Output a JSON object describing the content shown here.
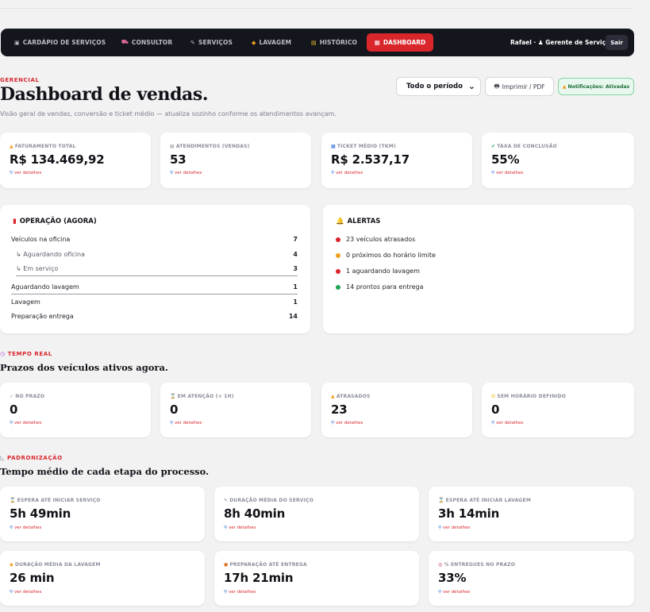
{
  "nav": {
    "items": [
      {
        "icon": "▣",
        "label": "CARDÁPIO DE SERVIÇOS"
      },
      {
        "icon": "⛟",
        "label": "CONSULTOR"
      },
      {
        "icon": "✎",
        "label": "SERVIÇOS"
      },
      {
        "icon": "◆",
        "label": "LAVAGEM"
      },
      {
        "icon": "▤",
        "label": "HISTÓRICO"
      }
    ],
    "active": {
      "icon": "▦",
      "label": "DASHBOARD"
    },
    "user": "Rafael · ♟ Gerente de Serviços",
    "logout": "Sair"
  },
  "header": {
    "eyebrow": "GERENCIAL",
    "title": "Dashboard de vendas.",
    "subtitle": "Visão geral de vendas, conversão e ticket médio — atualiza sozinho conforme os atendimentos avançam.",
    "period": "Todo o período",
    "print": "Imprimir / PDF",
    "notifications": "Notificações: Ativadas"
  },
  "link_label": "ver detalhes",
  "kpis": [
    {
      "icon": "▲",
      "label": "FATURAMENTO TOTAL",
      "value": "R$ 134.469,92"
    },
    {
      "icon": "▤",
      "label": "ATENDIMENTOS (VENDAS)",
      "value": "53"
    },
    {
      "icon": "▦",
      "label": "TICKET MÉDIO (TKM)",
      "value": "R$ 2.537,17"
    },
    {
      "icon": "✔",
      "label": "TAXA DE CONCLUSÃO",
      "value": "55%"
    }
  ],
  "operation": {
    "title": "OPERAÇÃO (AGORA)",
    "rows": [
      {
        "label": "Veículos na oficina",
        "value": "7"
      },
      {
        "label": "↳ Aguardando oficina",
        "value": "4"
      },
      {
        "label": "↳ Em serviço",
        "value": "3"
      },
      {
        "label": "Aguardando lavagem",
        "value": "1"
      },
      {
        "label": "Lavagem",
        "value": "1"
      },
      {
        "label": "Preparação entrega",
        "value": "14"
      }
    ]
  },
  "alerts": {
    "title": "ALERTAS",
    "items": [
      {
        "text": "23 veículos atrasados",
        "color": "#d9262b"
      },
      {
        "text": "0 próximos do horário limite",
        "color": "#f0a020"
      },
      {
        "text": "1 aguardando lavagem",
        "color": "#d9262b"
      },
      {
        "text": "14 prontos para entrega",
        "color": "#23a455"
      }
    ]
  },
  "realtime": {
    "eyebrow": "TEMPO REAL",
    "title": "Prazos dos veículos ativos agora.",
    "cards": [
      {
        "icon": "✓",
        "label": "NO PRAZO",
        "value": "0"
      },
      {
        "icon": "⌛",
        "label": "EM ATENÇÃO (< 1H)",
        "value": "0"
      },
      {
        "icon": "▲",
        "label": "ATRASADOS",
        "value": "23"
      },
      {
        "icon": "∅",
        "label": "SEM HORÁRIO DEFINIDO",
        "value": "0"
      }
    ]
  },
  "standard": {
    "eyebrow": "PADRONIZAÇÃO",
    "title": "Tempo médio de cada etapa do processo.",
    "cards": [
      {
        "icon": "⌛",
        "label": "ESPERA ATÉ INICIAR SERVIÇO",
        "value": "5h 49min"
      },
      {
        "icon": "✎",
        "label": "DURAÇÃO MÉDIA DO SERVIÇO",
        "value": "8h 40min"
      },
      {
        "icon": "⌛",
        "label": "ESPERA ATÉ INICIAR LAVAGEM",
        "value": "3h 14min"
      },
      {
        "icon": "◆",
        "label": "DURAÇÃO MÉDIA DA LAVAGEM",
        "value": "26 min"
      },
      {
        "icon": "●",
        "label": "PREPARAÇÃO ATÉ ENTREGA",
        "value": "17h 21min"
      },
      {
        "icon": "◎",
        "label": "% ENTREGUES NO PRAZO",
        "value": "33%"
      }
    ]
  },
  "colors": {
    "accent": "#d9262b",
    "nav_bg": "#14161d",
    "success": "#23a455",
    "warning": "#f0a020"
  }
}
